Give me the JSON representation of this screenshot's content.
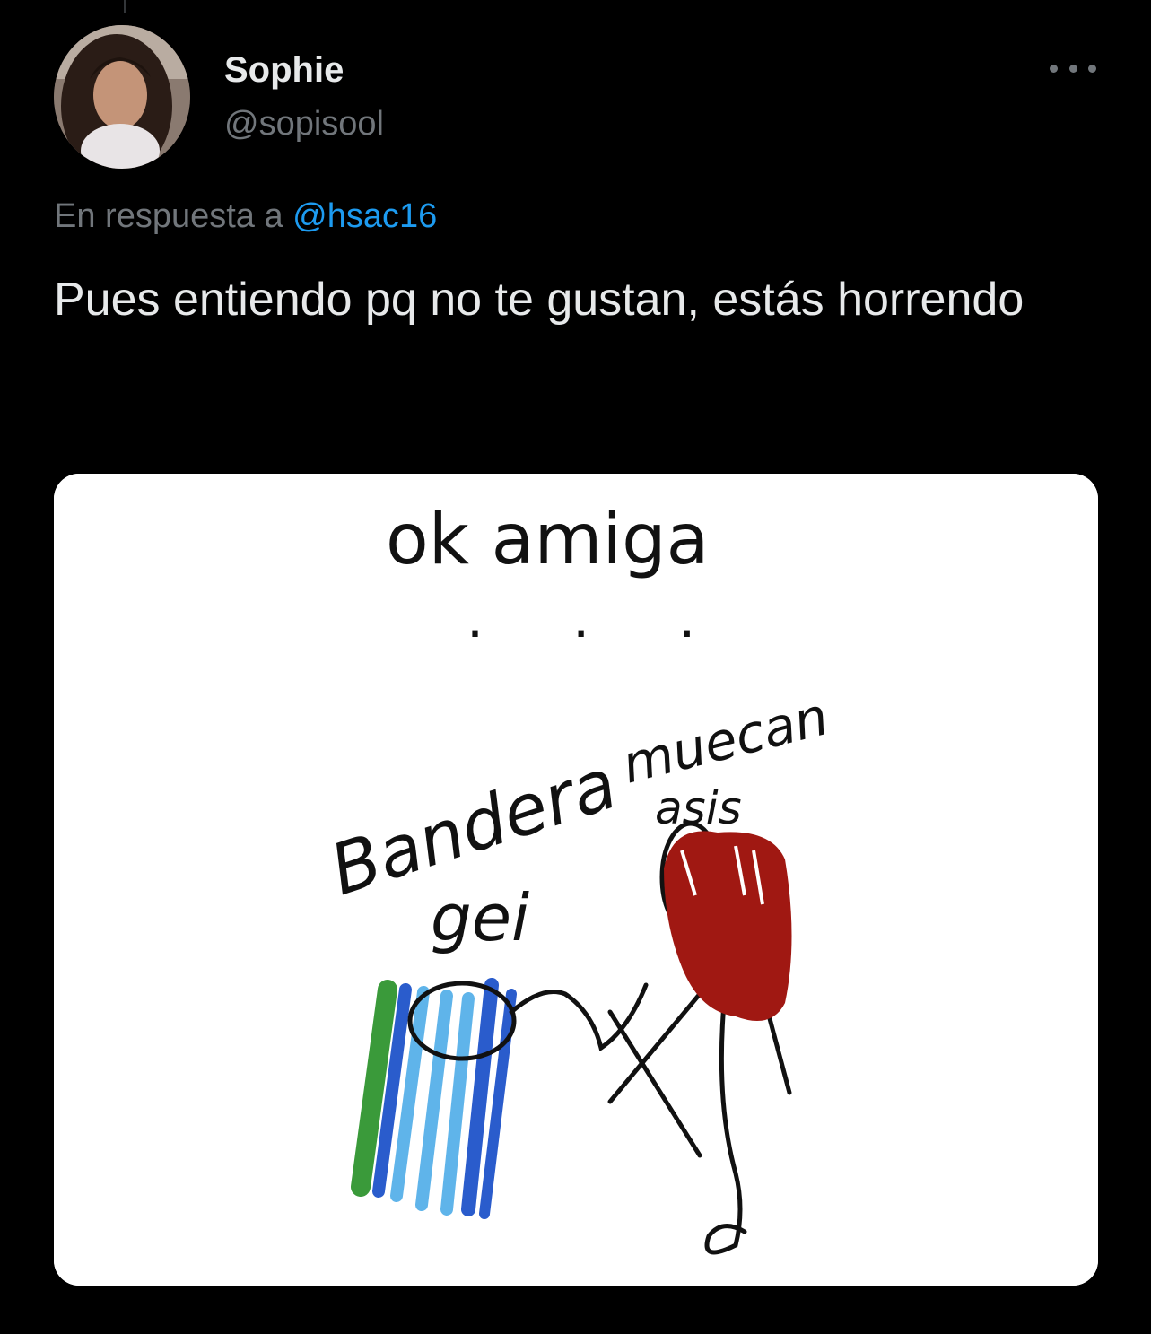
{
  "tweet": {
    "display_name": "Sophie",
    "handle": "@sopisool",
    "reply_prefix": "En respuesta a",
    "reply_to": "@hsac16",
    "text": "Pues entiendo pq no te gustan, estás horrendo",
    "more_icon": "more-horizontal-icon"
  },
  "media": {
    "caption_top": "ok amiga",
    "dots": ". . .",
    "label_flag_line1": "Bandera",
    "label_flag_line2": "gei",
    "label_face_line1": "muecan",
    "label_face_line2": "asis"
  },
  "colors": {
    "background": "#000000",
    "text_primary": "#e7e9ea",
    "text_secondary": "#71767b",
    "link": "#1d9bf0",
    "flag_green": "#3a9a3a",
    "flag_blue_dark": "#2a5ccc",
    "flag_blue_light": "#5fb4ea",
    "hair_red": "#a01812"
  }
}
